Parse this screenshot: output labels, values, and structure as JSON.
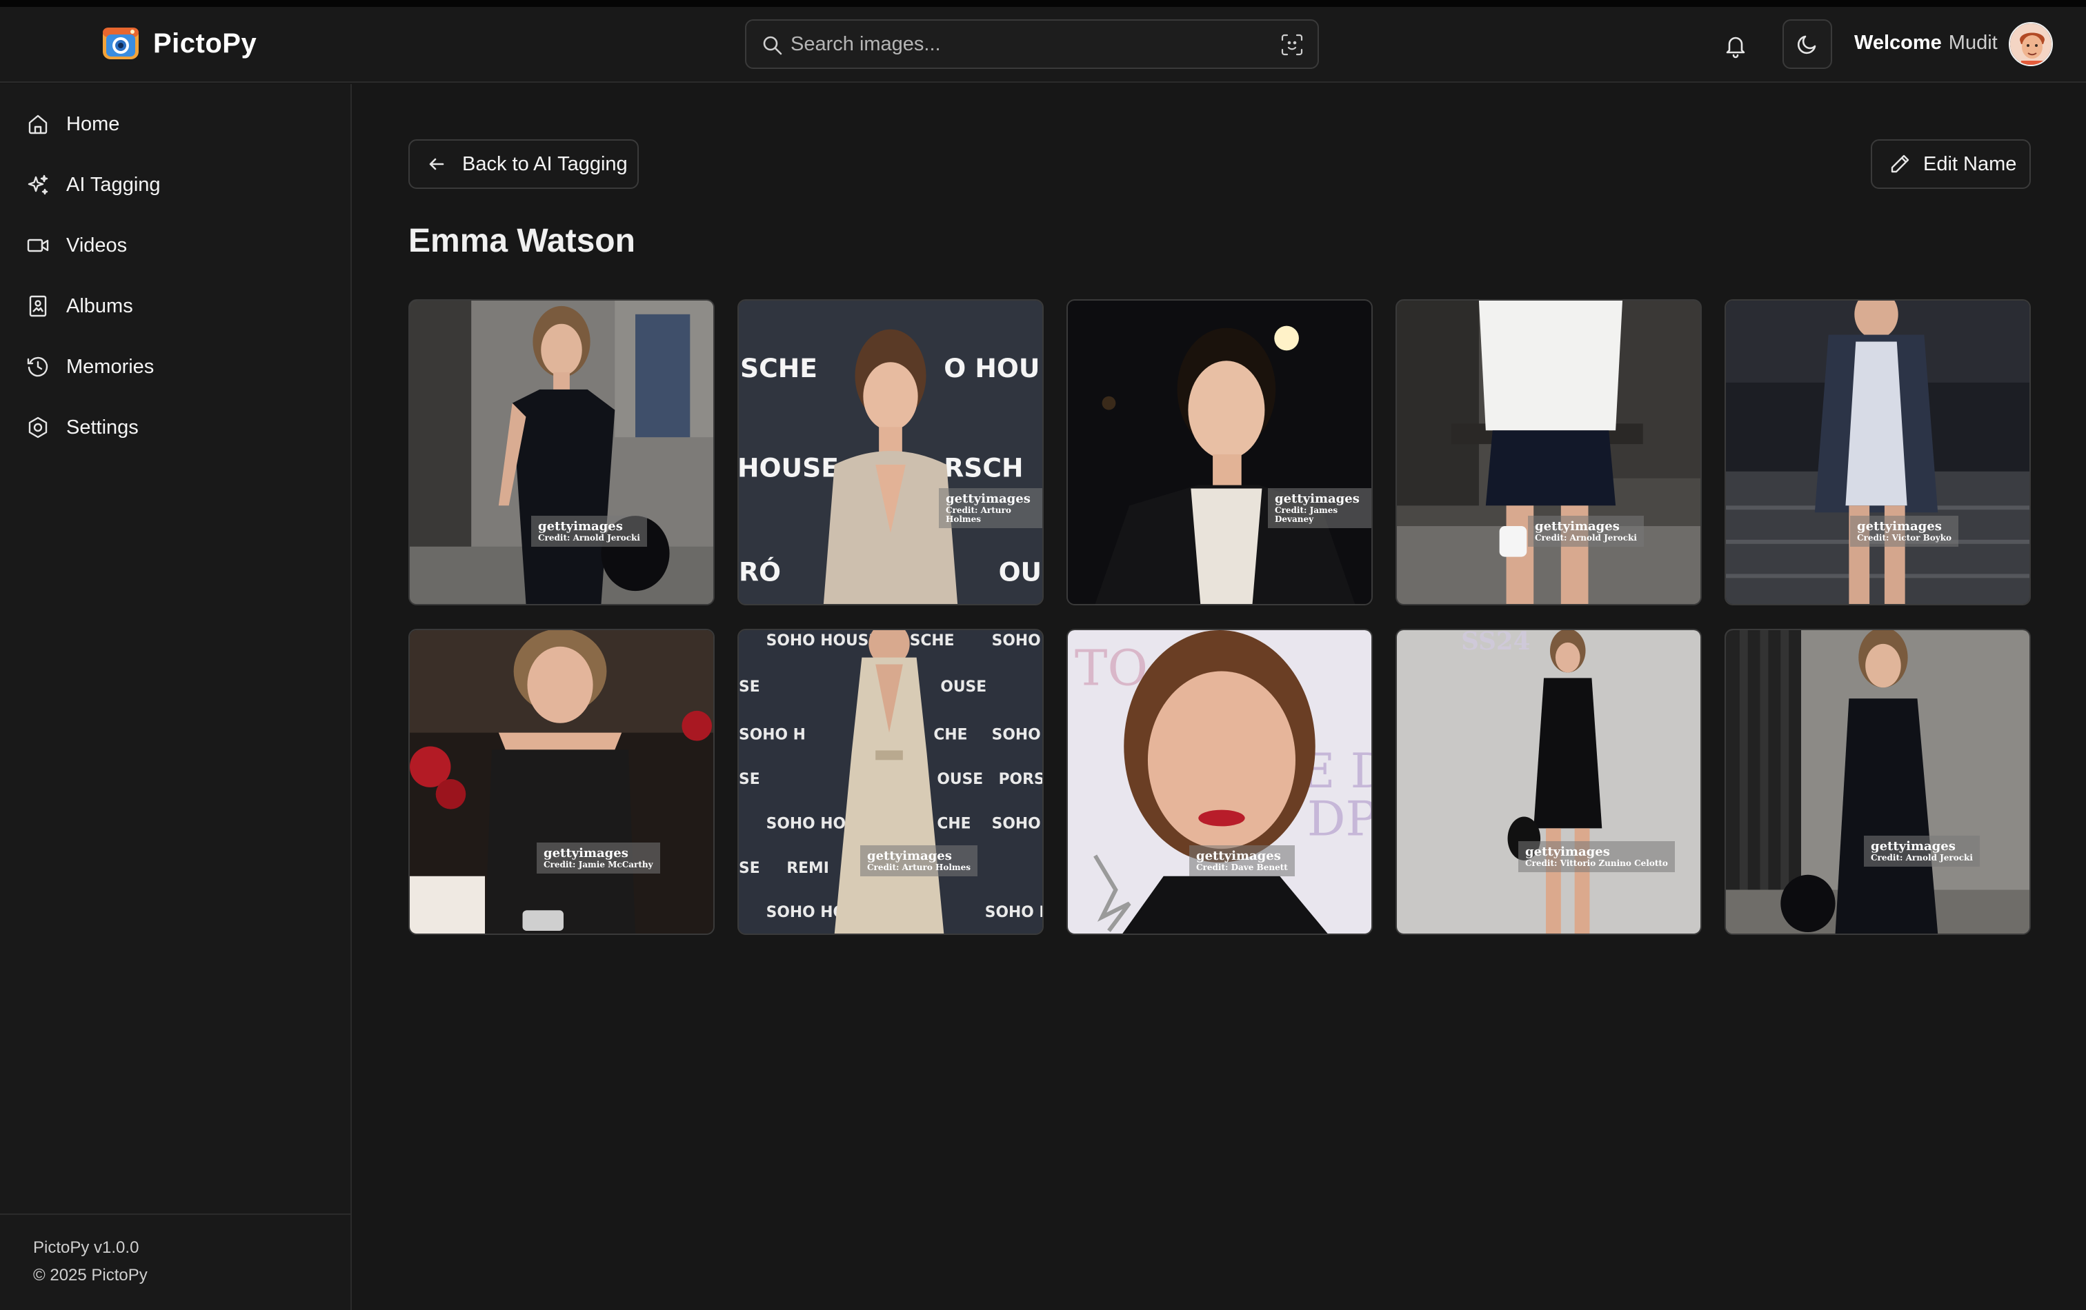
{
  "app": {
    "brand_name": "PictoPy",
    "search_placeholder": "Search images...",
    "welcome_text": "Welcome",
    "user_name": "Mudit"
  },
  "sidebar": {
    "items": [
      {
        "label": "Home",
        "icon": "home-icon"
      },
      {
        "label": "AI Tagging",
        "icon": "sparkles-icon"
      },
      {
        "label": "Videos",
        "icon": "video-icon"
      },
      {
        "label": "Albums",
        "icon": "album-icon"
      },
      {
        "label": "Memories",
        "icon": "clock-icon"
      },
      {
        "label": "Settings",
        "icon": "gear-icon"
      }
    ],
    "version": "PictoPy v1.0.0",
    "copyright": "© 2025 PictoPy"
  },
  "main": {
    "back_label": "Back to AI Tagging",
    "edit_label": "Edit Name",
    "person_name": "Emma Watson",
    "images": [
      {
        "watermark": "gettyimages",
        "credit": "Credit: Arnold Jerocki"
      },
      {
        "watermark": "gettyimages",
        "credit": "Credit: Arturo Holmes"
      },
      {
        "watermark": "gettyimages",
        "credit": "Credit: James Devaney"
      },
      {
        "watermark": "gettyimages",
        "credit": "Credit: Arnold Jerocki"
      },
      {
        "watermark": "gettyimages",
        "credit": "Credit: Victor Boyko"
      },
      {
        "watermark": "gettyimages",
        "credit": "Credit: Jamie McCarthy"
      },
      {
        "watermark": "gettyimages",
        "credit": "Credit: Arturo Holmes"
      },
      {
        "watermark": "gettyimages",
        "credit": "Credit: Dave Benett"
      },
      {
        "watermark": "gettyimages",
        "credit": "Credit: Vittorio Zunino Celotto"
      },
      {
        "watermark": "gettyimages",
        "credit": "Credit: Arnold Jerocki"
      }
    ]
  },
  "colors": {
    "background": "#171717",
    "panel": "#191919",
    "border": "#3a3a3a",
    "text": "#f2f2f2"
  }
}
